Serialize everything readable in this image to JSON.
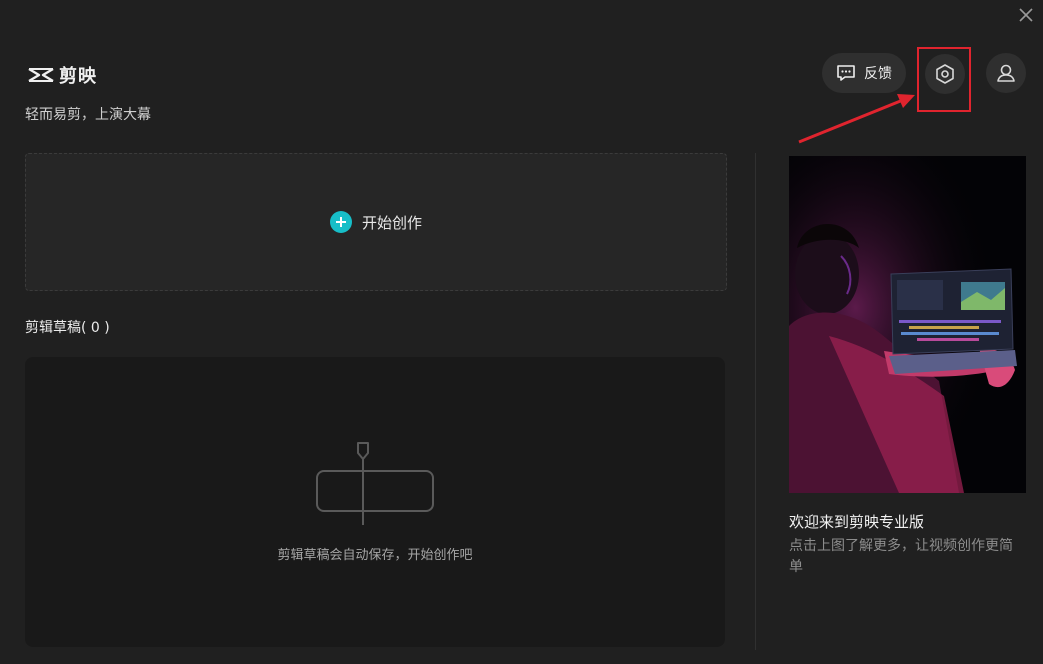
{
  "app": {
    "name": "剪映",
    "tagline": "轻而易剪，上演大幕"
  },
  "header": {
    "feedback_label": "反馈",
    "settings_icon": "settings-hexagon-icon",
    "avatar_icon": "user-icon",
    "close_icon": "close-icon"
  },
  "start": {
    "label": "开始创作",
    "icon": "plus-circle-icon",
    "accent": "#17bec8"
  },
  "drafts": {
    "title": "剪辑草稿( 0 )",
    "empty_text": "剪辑草稿会自动保存，开始创作吧"
  },
  "promo": {
    "title": "欢迎来到剪映专业版",
    "description": "点击上图了解更多，让视频创作更简单"
  },
  "annotation": {
    "color": "#e0242e"
  }
}
